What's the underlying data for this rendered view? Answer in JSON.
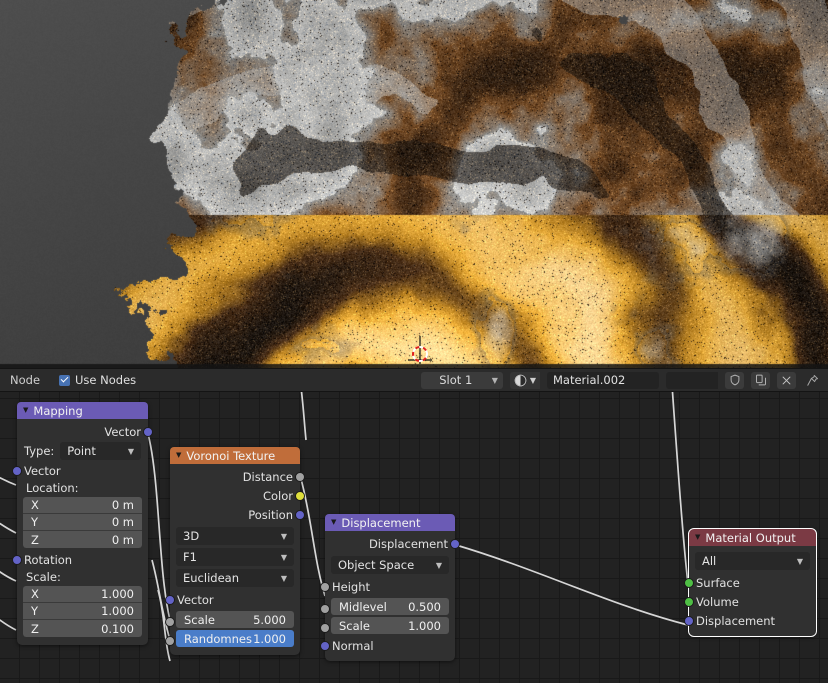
{
  "app": {
    "name": "Blender Shader Editor"
  },
  "viewport": {
    "name": "3d-viewport",
    "cursor_icon": "3d-cursor",
    "background_color": "#424242",
    "render_description": "Noisy displaced organic mesh with golden-orange swirling bands, dark brown and grey speckled regions over grey background"
  },
  "header": {
    "menu_label": "Node",
    "use_nodes_label": "Use Nodes",
    "use_nodes_checked": true,
    "slot_value": "Slot 1",
    "material_icon": "material-sphere-icon",
    "material_name": "Material.002",
    "shield_icon": "shield-icon",
    "copy_icon": "copy-icon",
    "close_icon": "x-icon",
    "pin_icon": "pin-icon"
  },
  "nodes": {
    "mapping": {
      "title": "Mapping",
      "header_color": "#6b5bb5",
      "outputs": [
        {
          "label": "Vector",
          "socket": "vector"
        }
      ],
      "type_label": "Type:",
      "type_value": "Point",
      "input_vector_label": "Vector",
      "location_label": "Location:",
      "location": [
        {
          "axis": "X",
          "value": "0 m"
        },
        {
          "axis": "Y",
          "value": "0 m"
        },
        {
          "axis": "Z",
          "value": "0 m"
        }
      ],
      "rotation_label": "Rotation",
      "scale_label": "Scale:",
      "scale": [
        {
          "axis": "X",
          "value": "1.000"
        },
        {
          "axis": "Y",
          "value": "1.000"
        },
        {
          "axis": "Z",
          "value": "0.100"
        }
      ]
    },
    "voronoi": {
      "title": "Voronoi Texture",
      "header_color": "#c06d3a",
      "outputs": [
        {
          "label": "Distance",
          "socket": "gray"
        },
        {
          "label": "Color",
          "socket": "yellow"
        },
        {
          "label": "Position",
          "socket": "vector"
        }
      ],
      "dimension_value": "3D",
      "feature_value": "F1",
      "metric_value": "Euclidean",
      "input_vector_label": "Vector",
      "scale_label": "Scale",
      "scale_value": "5.000",
      "randomness_label": "Randomnes",
      "randomness_value": "1.000",
      "randomness_highlighted": true
    },
    "displacement": {
      "title": "Displacement",
      "header_color": "#6b5bb5",
      "outputs": [
        {
          "label": "Displacement",
          "socket": "vector"
        }
      ],
      "space_value": "Object Space",
      "height_label": "Height",
      "midlevel_label": "Midlevel",
      "midlevel_value": "0.500",
      "scale_label": "Scale",
      "scale_value": "1.000",
      "normal_label": "Normal"
    },
    "material_output": {
      "title": "Material Output",
      "header_color": "#7b3a44",
      "selected": true,
      "target_value": "All",
      "inputs": [
        {
          "label": "Surface",
          "socket": "green"
        },
        {
          "label": "Volume",
          "socket": "green"
        },
        {
          "label": "Displacement",
          "socket": "vector"
        }
      ]
    }
  },
  "editor": {
    "background_color": "#222222",
    "grid_color": "#191919",
    "link_color": "#d6d6d6"
  }
}
